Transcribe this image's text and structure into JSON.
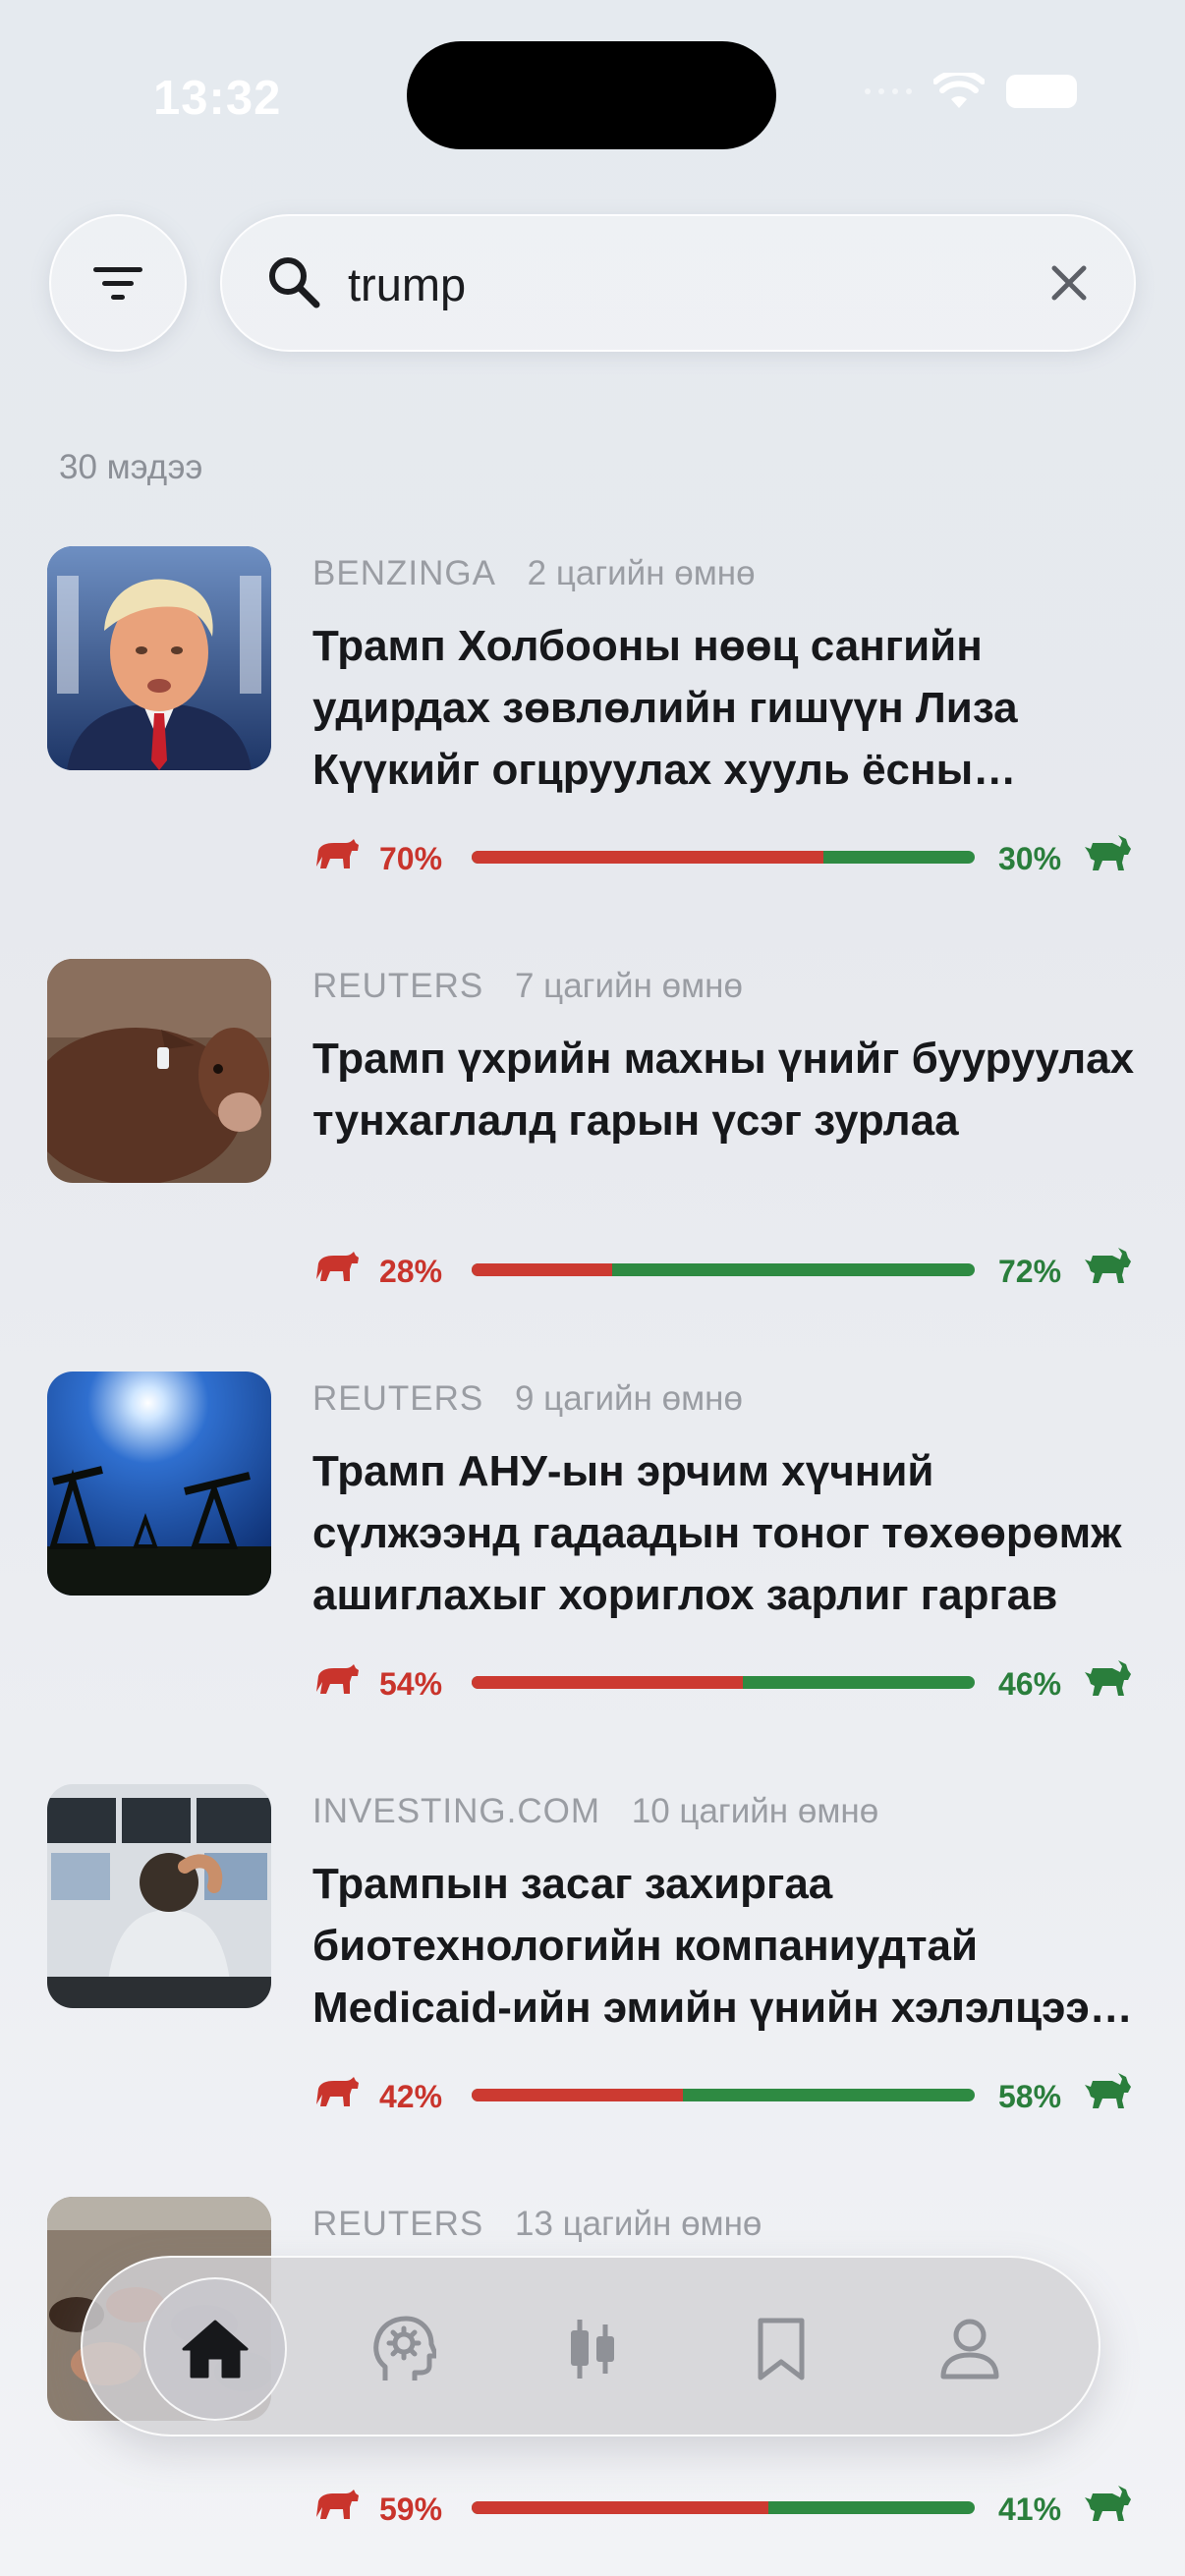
{
  "status": {
    "time": "13:32"
  },
  "search": {
    "value": "trump",
    "placeholder": "Search"
  },
  "results_count": "30 мэдээ",
  "colors": {
    "bear": "#cc3a31",
    "bull": "#2e8a42"
  },
  "articles": [
    {
      "source": "BENZINGA",
      "time": "2 цагийн өмнө",
      "title": "Трамп Холбооны нөөц сангийн удирдах зөвлөлийн гишүүн Лиза Күүкийг огцруулах хууль ёсны үндэслэлээ баталгаажуулав",
      "bear": 0.7,
      "bull": 0.3,
      "bear_label": "70%",
      "bull_label": "30%",
      "image": "portrait-photo"
    },
    {
      "source": "REUTERS",
      "time": "7 цагийн өмнө",
      "title": "Трамп үхрийн махны үнийг бууруулах тунхаглалд гарын үсэг зурлаа",
      "bear": 0.28,
      "bull": 0.72,
      "bear_label": "28%",
      "bull_label": "72%",
      "image": "cattle-photo"
    },
    {
      "source": "REUTERS",
      "time": "9 цагийн өмнө",
      "title": "Трамп АНУ-ын эрчим хүчний сүлжээнд гадаадын тоног төхөөрөмж ашиглахыг хориглох зарлиг гаргав",
      "bear": 0.54,
      "bull": 0.46,
      "bear_label": "54%",
      "bull_label": "46%",
      "image": "oil-pumps-photo"
    },
    {
      "source": "INVESTING.COM",
      "time": "10 цагийн өмнө",
      "title": "Трампын засаг захиргаа биотехнологийн компаниудтай Medicaid-ийн эмийн үнийн хэлэлцээ хийж байна",
      "bear": 0.42,
      "bull": 0.58,
      "bear_label": "42%",
      "bull_label": "58%",
      "image": "trader-photo"
    },
    {
      "source": "REUTERS",
      "time": "13 цагийн өмнө",
      "title": "",
      "bear": 0.59,
      "bull": 0.41,
      "bear_label": "59%",
      "bull_label": "41%",
      "image": "cattle-yard-photo"
    }
  ],
  "tabbar": {
    "items": [
      "home-icon",
      "brain-gear-icon",
      "candlestick-icon",
      "bookmark-icon",
      "profile-icon"
    ],
    "active": "home-icon"
  }
}
